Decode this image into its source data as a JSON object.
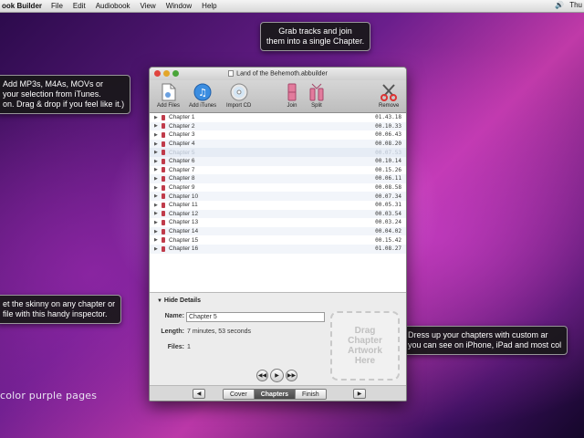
{
  "menubar": {
    "app_name": "ook Builder",
    "items": [
      "File",
      "Edit",
      "Audiobook",
      "View",
      "Window",
      "Help"
    ],
    "right_text": "Thu"
  },
  "window": {
    "title": "Land of the Behemoth.abbuilder"
  },
  "toolbar": {
    "add_files": "Add Files",
    "add_itunes": "Add iTunes",
    "import_cd": "Import CD",
    "join": "Join",
    "split": "Split",
    "remove": "Remove"
  },
  "chapters": [
    {
      "name": "Chapter 1",
      "duration": "01.43.18"
    },
    {
      "name": "Chapter 2",
      "duration": "00.10.33"
    },
    {
      "name": "Chapter 3",
      "duration": "00.06.43"
    },
    {
      "name": "Chapter 4",
      "duration": "00.08.20"
    },
    {
      "name": "Chapter 5",
      "duration": "00.07.53"
    },
    {
      "name": "Chapter 6",
      "duration": "00.10.14"
    },
    {
      "name": "Chapter 7",
      "duration": "00.15.26"
    },
    {
      "name": "Chapter 8",
      "duration": "00.06.11"
    },
    {
      "name": "Chapter 9",
      "duration": "00.08.58"
    },
    {
      "name": "Chapter 10",
      "duration": "00.07.34"
    },
    {
      "name": "Chapter 11",
      "duration": "00.05.31"
    },
    {
      "name": "Chapter 12",
      "duration": "00.03.54"
    },
    {
      "name": "Chapter 13",
      "duration": "00.03.24"
    },
    {
      "name": "Chapter 14",
      "duration": "00.04.02"
    },
    {
      "name": "Chapter 15",
      "duration": "00.15.42"
    },
    {
      "name": "Chapter 16",
      "duration": "01.08.27"
    }
  ],
  "selected_index": 4,
  "details": {
    "toggle_label": "Hide Details",
    "name_label": "Name:",
    "name_value": "Chapter 5",
    "length_label": "Length:",
    "length_value": "7 minutes, 53 seconds",
    "files_label": "Files:",
    "files_value": "1",
    "artwork_l1": "Drag",
    "artwork_l2": "Chapter",
    "artwork_l3": "Artwork",
    "artwork_l4": "Here"
  },
  "nav": {
    "tabs": [
      "Cover",
      "Chapters",
      "Finish"
    ],
    "active_tab": "Chapters"
  },
  "tooltips": {
    "join": [
      "Grab tracks and join",
      "them into a single Chapter."
    ],
    "add": [
      "Add MP3s, M4As, MOVs or",
      "your selection from iTunes.",
      "on. Drag & drop if you feel like it.)"
    ],
    "inspector": [
      "et the skinny on any chapter or",
      "file with this handy inspector."
    ],
    "artwork": [
      "Dress up your chapters with custom ar",
      "you can see on iPhone, iPad and most col"
    ]
  },
  "caption": "color purple pages"
}
